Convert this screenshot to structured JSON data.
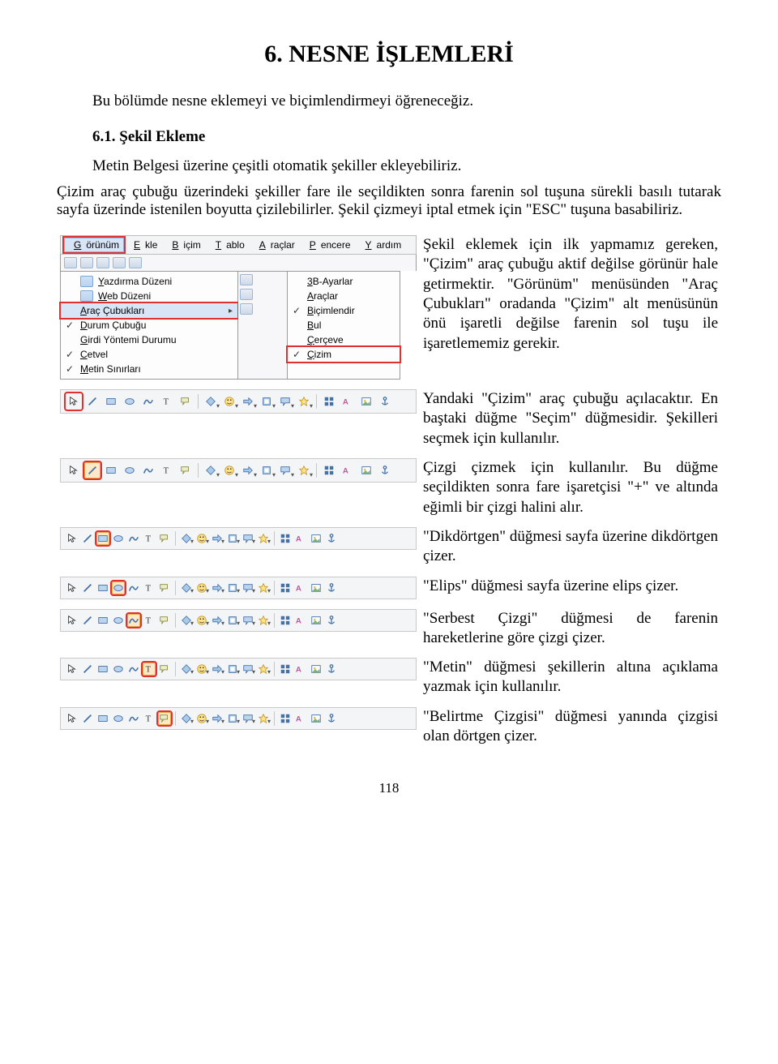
{
  "title": "6. NESNE İŞLEMLERİ",
  "intro": "Bu bölümde nesne eklemeyi ve biçimlendirmeyi öğreneceğiz.",
  "h2": "6.1. Şekil Ekleme",
  "para1": "Metin Belgesi üzerine çeşitli otomatik şekiller ekleyebiliriz.",
  "para2": "Çizim araç çubuğu üzerindeki şekiller fare ile seçildikten sonra farenin sol tuşuna sürekli basılı tutarak sayfa üzerinde istenilen boyutta çizilebilirler. Şekil çizmeyi iptal etmek için \"ESC\" tuşuna basabiliriz.",
  "menu": {
    "top": [
      "Görünüm",
      "Ekle",
      "Biçim",
      "Tablo",
      "Araçlar",
      "Pencere",
      "Yardım"
    ],
    "left_items": [
      {
        "label": "Yazdırma Düzeni",
        "icon": true,
        "check": false
      },
      {
        "label": "Web Düzeni",
        "icon": true,
        "check": false
      },
      {
        "label": "Araç Çubukları",
        "icon": false,
        "check": false,
        "arrow": true,
        "hilite": true,
        "red": true
      },
      {
        "label": "Durum Çubuğu",
        "icon": false,
        "check": true
      },
      {
        "label": "Girdi Yöntemi Durumu",
        "icon": false,
        "check": false
      },
      {
        "label": "Cetvel",
        "icon": false,
        "check": true
      },
      {
        "label": "Metin Sınırları",
        "icon": false,
        "check": true
      }
    ],
    "right_items": [
      {
        "label": "3B-Ayarlar",
        "check": false
      },
      {
        "label": "Araçlar",
        "check": false
      },
      {
        "label": "Biçimlendir",
        "check": true
      },
      {
        "label": "Bul",
        "check": false
      },
      {
        "label": "Çerçeve",
        "check": false
      },
      {
        "label": "Çizim",
        "check": true,
        "red": true
      }
    ]
  },
  "rows": [
    {
      "text": "Şekil eklemek için ilk yapmamız gereken, \"Çizim\" araç çubuğu aktif değilse görünür hale getirmektir. \"Görünüm\" menüsünden \"Araç Çubukları\" oradanda \"Çizim\" alt menüsünün önü işaretli değilse farenin sol tuşu ile işaretlememiz gerekir."
    },
    {
      "text": "Yandaki \"Çizim\" araç çubuğu açılacaktır. En baştaki düğme \"Seçim\" düğmesidir. Şekilleri seçmek için kullanılır.",
      "hl": 0
    },
    {
      "text": "Çizgi çizmek için kullanılır. Bu düğme seçildikten sonra fare işaretçisi \"+\" ve altında eğimli bir çizgi halini alır.",
      "hl": 1
    },
    {
      "text": "\"Dikdörtgen\" düğmesi sayfa üzerine dikdörtgen çizer.",
      "small": true,
      "hl": 2
    },
    {
      "text": "\"Elips\" düğmesi sayfa üzerine elips çizer.",
      "small": true,
      "hl": 3
    },
    {
      "text": "\"Serbest Çizgi\" düğmesi de farenin hareketlerine göre çizgi çizer.",
      "small": true,
      "hl": 4
    },
    {
      "text": "\"Metin\" düğmesi şekillerin altına açıklama yazmak için kullanılır.",
      "small": true,
      "hl": 5
    },
    {
      "text": "\"Belirtme Çizgisi\" düğmesi yanında çizgisi olan dörtgen çizer.",
      "small": true,
      "hl": 6
    }
  ],
  "page_number": "118"
}
